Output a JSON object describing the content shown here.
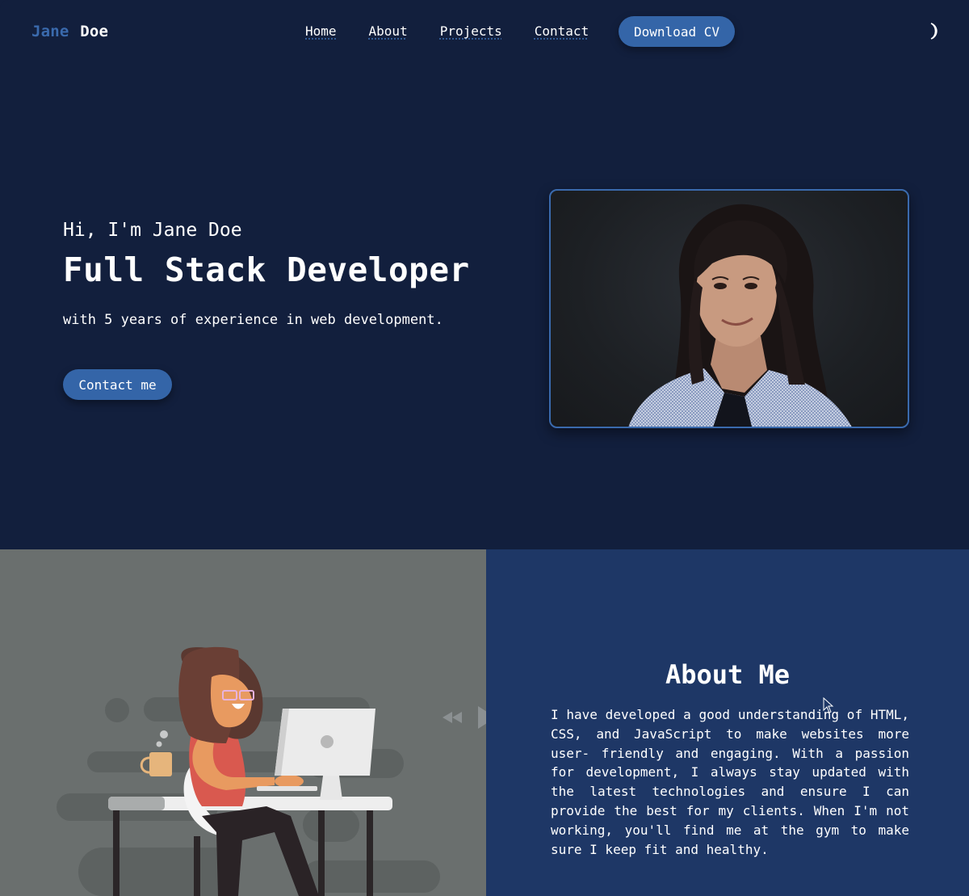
{
  "nav": {
    "logo_first": "Jane",
    "logo_last": "Doe",
    "links": [
      {
        "label": "Home"
      },
      {
        "label": "About"
      },
      {
        "label": "Projects"
      },
      {
        "label": "Contact"
      }
    ],
    "cta_label": "Download CV",
    "theme_toggle_icon": "moon-icon"
  },
  "hero": {
    "greeting": "Hi, I'm Jane Doe",
    "title": "Full Stack Developer",
    "subtitle": "with 5 years of experience in web development.",
    "contact_label": "Contact me",
    "portrait_alt": "Portrait of Jane Doe"
  },
  "about": {
    "title": "About Me",
    "body": "I have developed a good understanding of HTML, CSS, and JavaScript to make websites more user- friendly and engaging. With a passion for development, I always stay updated with the latest technologies and ensure I can provide the best for my clients. When I'm not working, you'll find me at the gym to make sure I keep fit and healthy.",
    "illustration": "woman-at-desk-illustration",
    "video_controls": [
      "rewind-icon",
      "play-icon",
      "fast-forward-icon"
    ]
  },
  "colors": {
    "background": "#121f3d",
    "accent": "#3465a8",
    "about_panel": "#1e3766",
    "illustration_bg": "#6a6f6e"
  }
}
